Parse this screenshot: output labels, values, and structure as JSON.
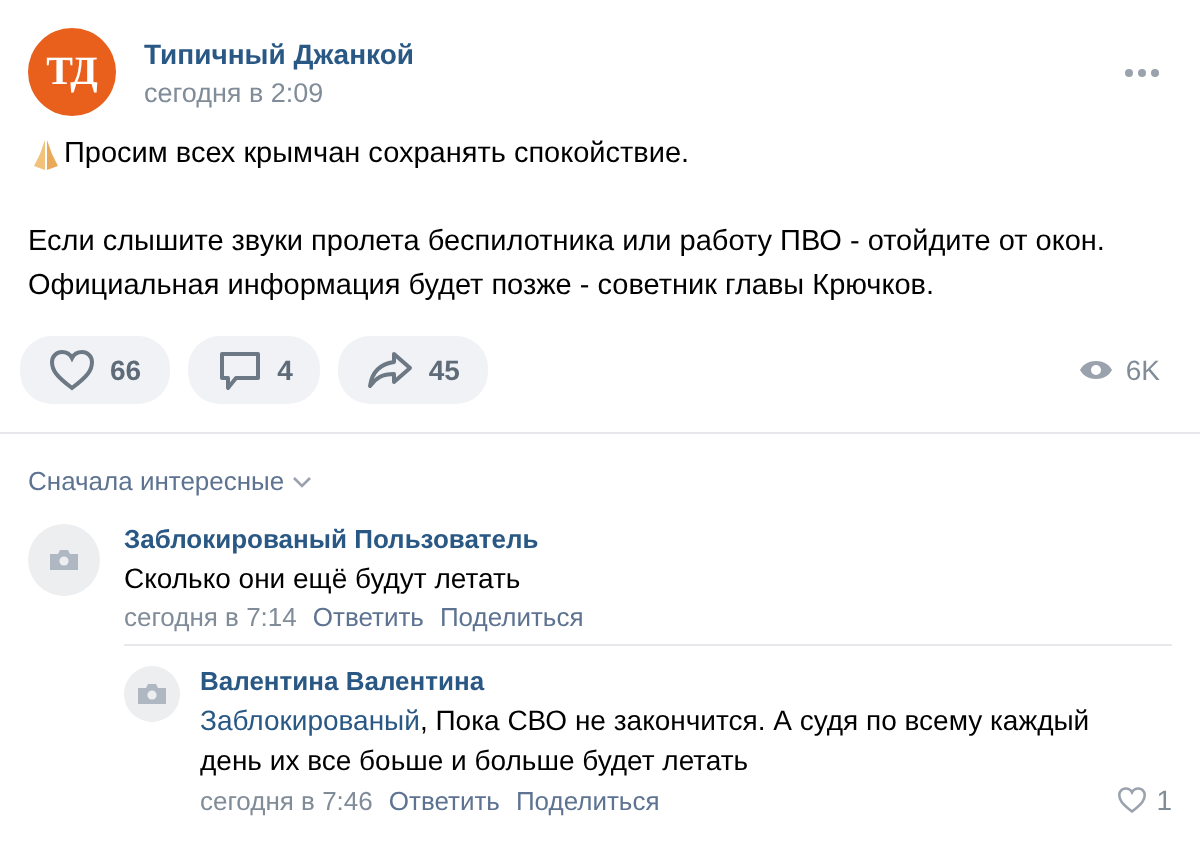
{
  "post": {
    "logo_text": "ТД",
    "author": "Типичный Джанкой",
    "time": "сегодня в 2:09",
    "paragraphs": [
      "Просим всех крымчан сохранять спокойствие.",
      "Если слышите звуки пролета беспилотника или работу ПВО - отойдите от окон. Официальная информация будет позже - советник главы Крючков."
    ],
    "actions": [
      {
        "kind": "like",
        "count": "66"
      },
      {
        "kind": "comment",
        "count": "4"
      },
      {
        "kind": "share",
        "count": "45"
      }
    ],
    "views": "6K"
  },
  "comments_sort": "Сначала интересные",
  "comments": [
    {
      "author": "Заблокированый Пользователь",
      "text": "Сколько они ещё будут летать",
      "time": "сегодня в 7:14",
      "reply": "Ответить",
      "share": "Поделиться",
      "reply_level": false
    },
    {
      "author": "Валентина Валентина",
      "mention": "Заблокированый",
      "text": ", Пока СВО не закончится. А судя по всему каждый день их все боьше и больше будет летать",
      "time": "сегодня в 7:46",
      "reply": "Ответить",
      "share": "Поделиться",
      "likes": "1",
      "reply_level": true
    }
  ]
}
